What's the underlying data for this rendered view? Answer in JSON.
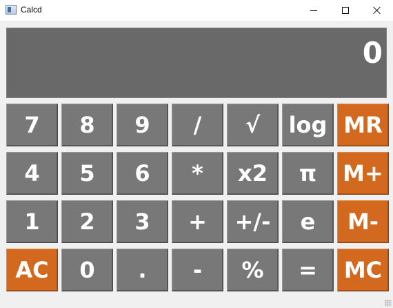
{
  "window": {
    "title": "Calcd",
    "app_icon": "calculator-app-icon",
    "controls": [
      "minimize-icon",
      "maximize-icon",
      "close-icon"
    ]
  },
  "display": {
    "value": "0"
  },
  "keys": [
    {
      "label": "7",
      "name": "key-7",
      "color": "gray"
    },
    {
      "label": "8",
      "name": "key-8",
      "color": "gray"
    },
    {
      "label": "9",
      "name": "key-9",
      "color": "gray"
    },
    {
      "label": "/",
      "name": "key-divide",
      "color": "gray"
    },
    {
      "label": "√",
      "name": "key-sqrt",
      "color": "gray"
    },
    {
      "label": "log",
      "name": "key-log",
      "color": "gray"
    },
    {
      "label": "MR",
      "name": "key-memory-recall",
      "color": "orange"
    },
    {
      "label": "4",
      "name": "key-4",
      "color": "gray"
    },
    {
      "label": "5",
      "name": "key-5",
      "color": "gray"
    },
    {
      "label": "6",
      "name": "key-6",
      "color": "gray"
    },
    {
      "label": "*",
      "name": "key-multiply",
      "color": "gray"
    },
    {
      "label": "x2",
      "name": "key-square",
      "color": "gray"
    },
    {
      "label": "π",
      "name": "key-pi",
      "color": "gray"
    },
    {
      "label": "M+",
      "name": "key-memory-add",
      "color": "orange"
    },
    {
      "label": "1",
      "name": "key-1",
      "color": "gray"
    },
    {
      "label": "2",
      "name": "key-2",
      "color": "gray"
    },
    {
      "label": "3",
      "name": "key-3",
      "color": "gray"
    },
    {
      "label": "+",
      "name": "key-add",
      "color": "gray"
    },
    {
      "label": "+/-",
      "name": "key-negate",
      "color": "gray"
    },
    {
      "label": "e",
      "name": "key-e",
      "color": "gray"
    },
    {
      "label": "M-",
      "name": "key-memory-subtract",
      "color": "orange"
    },
    {
      "label": "AC",
      "name": "key-all-clear",
      "color": "orange"
    },
    {
      "label": "0",
      "name": "key-0",
      "color": "gray"
    },
    {
      "label": ".",
      "name": "key-decimal",
      "color": "gray"
    },
    {
      "label": "-",
      "name": "key-subtract",
      "color": "gray"
    },
    {
      "label": "%",
      "name": "key-percent",
      "color": "gray"
    },
    {
      "label": "=",
      "name": "key-equals",
      "color": "gray"
    },
    {
      "label": "MC",
      "name": "key-memory-clear",
      "color": "orange"
    }
  ],
  "colors": {
    "key_gray": "#787878",
    "key_orange": "#d2691e",
    "display_bg": "#696969",
    "window_bg": "#f0f0f0"
  }
}
